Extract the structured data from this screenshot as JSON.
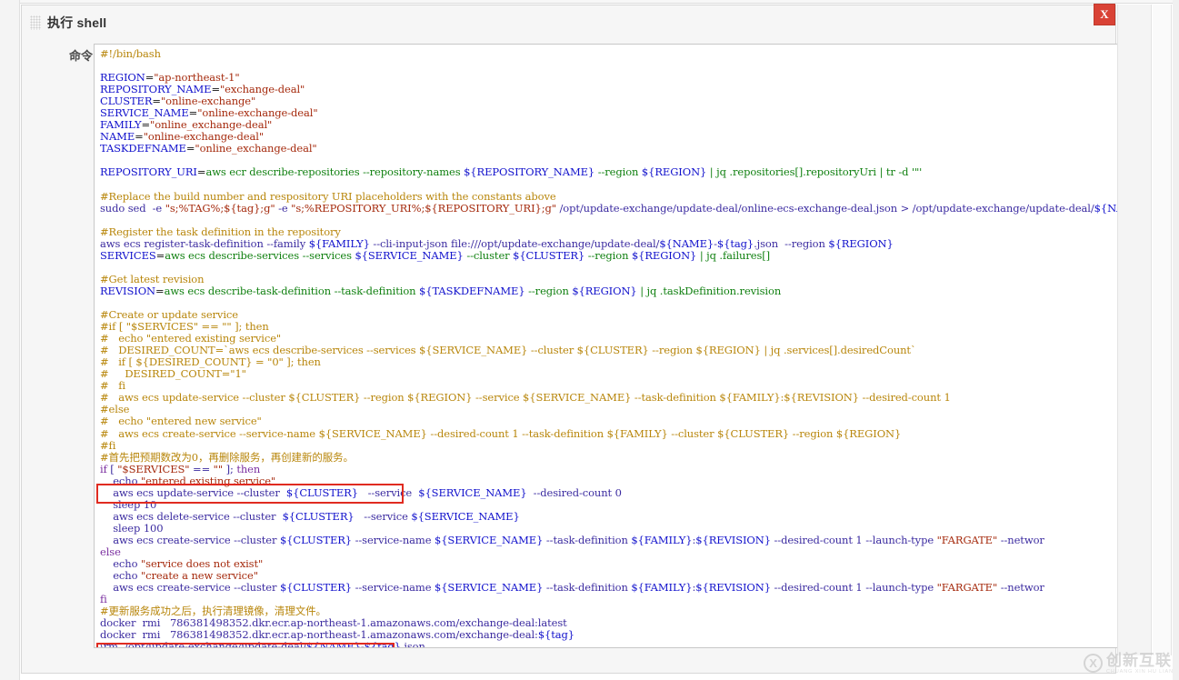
{
  "panel": {
    "title": "执行 shell",
    "field_label": "命令",
    "close_label": "X",
    "help_icon": "help-circle-icon",
    "drag_handle_icon": "drag-handle-icon",
    "accent_red": "#d94235",
    "annotation_red": "#e02b20"
  },
  "watermark": {
    "mark": "X",
    "cn": "创新互联",
    "pinyin": "CHUANG XIN HU LIAN"
  },
  "annotations": [
    {
      "id": "annot-1",
      "note": "red box around the first Chinese comment line"
    },
    {
      "id": "annot-2",
      "note": "red box around the second Chinese comment line"
    }
  ],
  "script": {
    "language": "bash",
    "lines": [
      "#!/bin/bash",
      "",
      "REGION=\"ap-northeast-1\"",
      "REPOSITORY_NAME=\"exchange-deal\"",
      "CLUSTER=\"online-exchange\"",
      "SERVICE_NAME=\"online-exchange-deal\"",
      "FAMILY=\"online_exchange-deal\"",
      "NAME=\"online-exchange-deal\"",
      "TASKDEFNAME=\"online_exchange-deal\"",
      "",
      "REPOSITORY_URI=`aws ecr describe-repositories --repository-names ${REPOSITORY_NAME} --region ${REGION} | jq .repositories[].repositoryUri | tr -d '\"'`",
      "",
      "#Replace the build number and respository URI placeholders with the constants above",
      "sudo sed  -e \"s;%TAG%;${tag};g\" -e \"s;%REPOSITORY_URI%;${REPOSITORY_URI};g\" /opt/update-exchange/update-deal/online-ecs-exchange-deal.json > /opt/update-exchange/update-deal/${NAME}-${tag}.json",
      "",
      "#Register the task definition in the repository",
      "aws ecs register-task-definition --family ${FAMILY} --cli-input-json file:///opt/update-exchange/update-deal/${NAME}-${tag}.json  --region ${REGION}",
      "SERVICES=`aws ecs describe-services --services ${SERVICE_NAME} --cluster ${CLUSTER} --region ${REGION} | jq .failures[]`",
      "",
      "#Get latest revision",
      "REVISION=`aws ecs describe-task-definition --task-definition ${TASKDEFNAME} --region ${REGION} | jq .taskDefinition.revision`",
      "",
      "#Create or update service",
      "#if [ \"$SERVICES\" == \"\" ]; then",
      "#   echo \"entered existing service\"",
      "#   DESIRED_COUNT=`aws ecs describe-services --services ${SERVICE_NAME} --cluster ${CLUSTER} --region ${REGION} | jq .services[].desiredCount`",
      "#   if [ ${DESIRED_COUNT} = \"0\" ]; then",
      "#     DESIRED_COUNT=\"1\"",
      "#   fi",
      "#   aws ecs update-service --cluster ${CLUSTER} --region ${REGION} --service ${SERVICE_NAME} --task-definition ${FAMILY}:${REVISION} --desired-count 1",
      "#else",
      "#   echo \"entered new service\"",
      "#   aws ecs create-service --service-name ${SERVICE_NAME} --desired-count 1 --task-definition ${FAMILY} --cluster ${CLUSTER} --region ${REGION}",
      "#fi",
      "#首先把预期数改为0，再删除服务，再创建新的服务。",
      "if [ \"$SERVICES\" == \"\" ]; then",
      "    echo \"entered existing service\"",
      "    aws ecs update-service --cluster  ${CLUSTER}   --service  ${SERVICE_NAME}  --desired-count 0",
      "    sleep 10",
      "    aws ecs delete-service --cluster  ${CLUSTER}   --service ${SERVICE_NAME}",
      "    sleep 100",
      "    aws ecs create-service --cluster ${CLUSTER} --service-name ${SERVICE_NAME} --task-definition ${FAMILY}:${REVISION} --desired-count 1 --launch-type \"FARGATE\" --networ",
      "else",
      "    echo \"service does not exist\"",
      "    echo \"create a new service\"",
      "    aws ecs create-service --cluster ${CLUSTER} --service-name ${SERVICE_NAME} --task-definition ${FAMILY}:${REVISION} --desired-count 1 --launch-type \"FARGATE\" --networ",
      "fi",
      "#更新服务成功之后，执行清理镜像，清理文件。",
      "docker  rmi   786381498352.dkr.ecr.ap-northeast-1.amazonaws.com/exchange-deal:latest",
      "docker  rmi   786381498352.dkr.ecr.ap-northeast-1.amazonaws.com/exchange-deal:${tag}",
      "\\rm  /opt/update-exchange/update-deal/${NAME}-${tag}.json"
    ],
    "highlighted_comments": [
      "#首先把预期数改为0，再删除服务，再创建新的服务。",
      "#更新服务成功之后，执行清理镜像，清理文件。"
    ]
  }
}
